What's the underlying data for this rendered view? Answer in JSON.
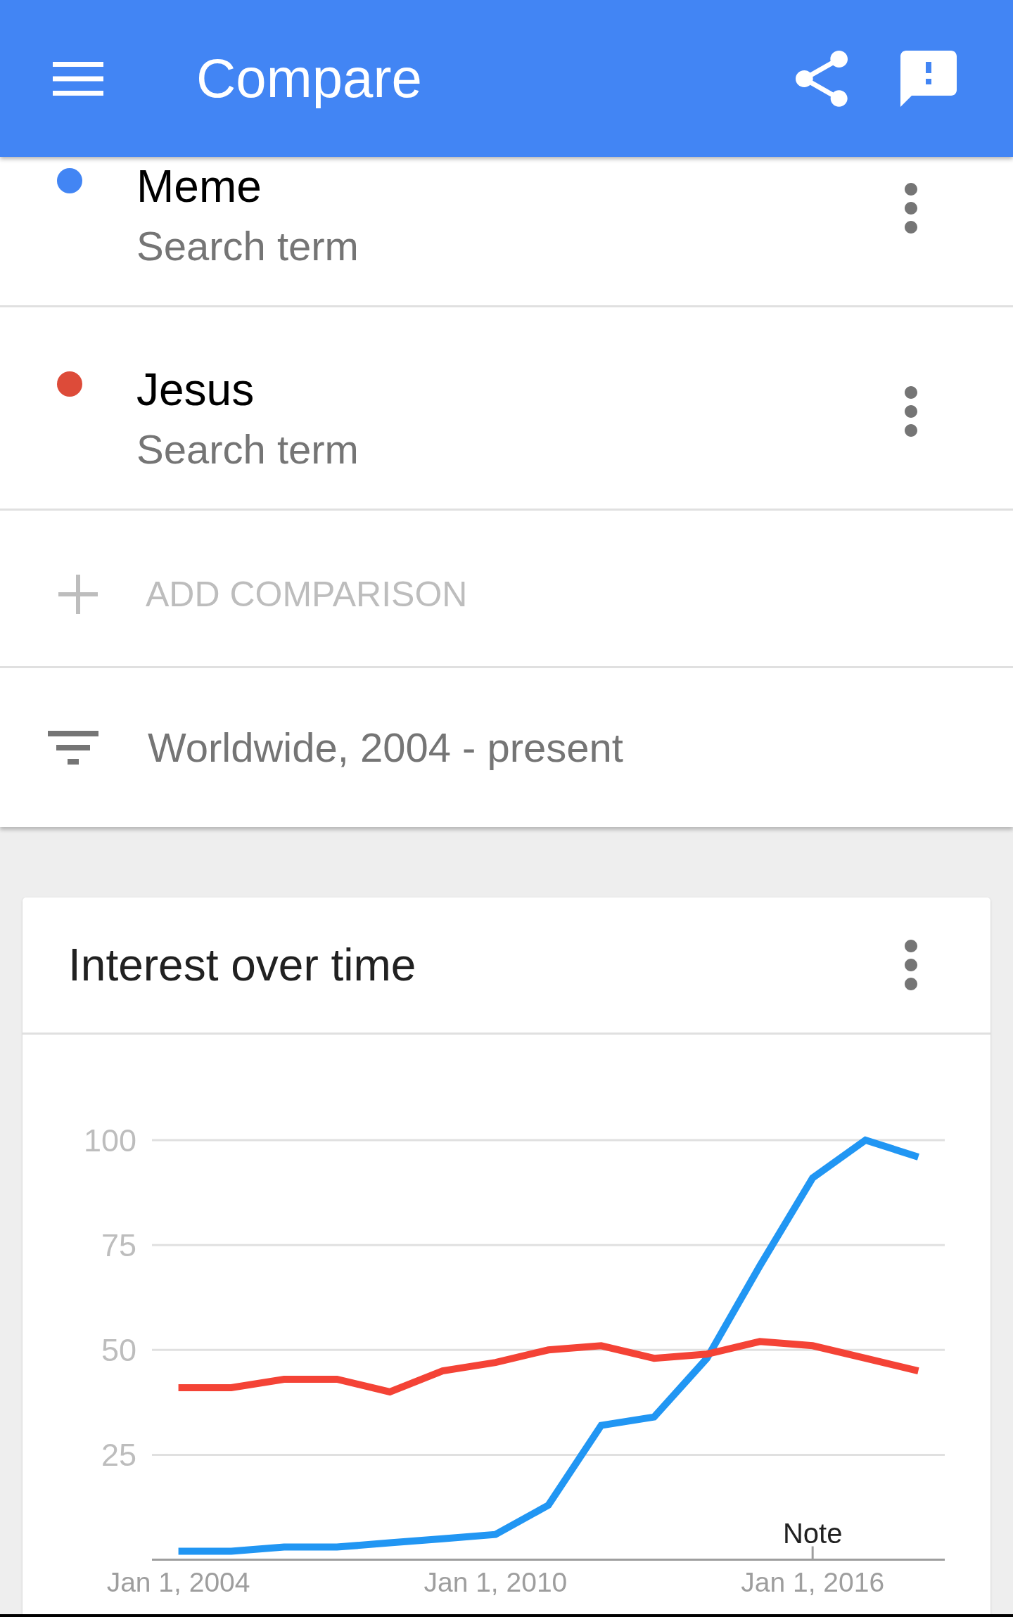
{
  "app_bar": {
    "title": "Compare"
  },
  "terms": [
    {
      "name": "Meme",
      "subtitle": "Search term",
      "color": "#4285f4"
    },
    {
      "name": "Jesus",
      "subtitle": "Search term",
      "color": "#dd4b39"
    }
  ],
  "add_comparison": {
    "label": "ADD COMPARISON"
  },
  "filter": {
    "label": "Worldwide, 2004 - present"
  },
  "card": {
    "title": "Interest over time",
    "chart_data": {
      "type": "line",
      "categories": [
        "Jan 1, 2004",
        null,
        null,
        null,
        null,
        null,
        "Jan 1, 2010",
        null,
        null,
        null,
        null,
        null,
        "Jan 1, 2016",
        null,
        null
      ],
      "ylim": [
        0,
        100
      ],
      "yticks": [
        25,
        50,
        75,
        100
      ],
      "grid": true,
      "series": [
        {
          "color": "#2196f3",
          "values": [
            2,
            2,
            3,
            3,
            4,
            5,
            6,
            13,
            32,
            34,
            48,
            70,
            91,
            100,
            96
          ]
        },
        {
          "color": "#f44336",
          "values": [
            41,
            41,
            43,
            43,
            40,
            45,
            47,
            50,
            51,
            48,
            49,
            52,
            51,
            48,
            45
          ]
        }
      ],
      "annotations": [
        {
          "x": "Jan 1, 2016",
          "text": "Note"
        }
      ]
    }
  }
}
